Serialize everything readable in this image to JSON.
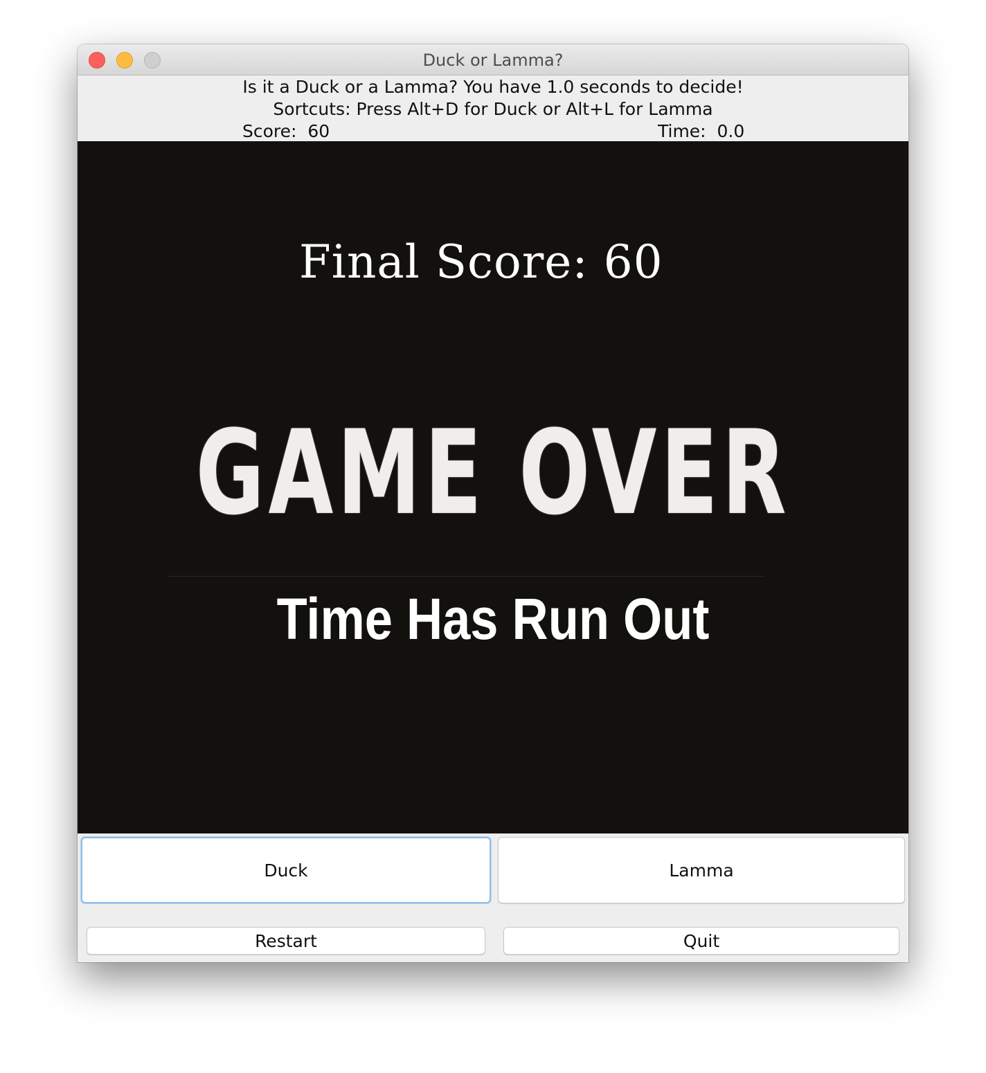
{
  "window": {
    "title": "Duck or Lamma?"
  },
  "info": {
    "instruction": "Is it a Duck or a Lamma? You have 1.0 seconds to decide!",
    "shortcuts": "Sortcuts: Press Alt+D for Duck or Alt+L for Lamma",
    "score": "Score:  60",
    "time": "Time:  0.0"
  },
  "game": {
    "final_score": "Final Score: 60",
    "game_over": "GAME OVER",
    "time_out": "Time Has Run Out"
  },
  "buttons": {
    "duck": "Duck",
    "lamma": "Lamma",
    "restart": "Restart",
    "quit": "Quit"
  },
  "colors": {
    "game_background": "#13110e",
    "focus_ring": "#8fbce6",
    "close": "#fc605c",
    "minimize": "#fdbc40",
    "maximize": "#cfcfcf"
  }
}
